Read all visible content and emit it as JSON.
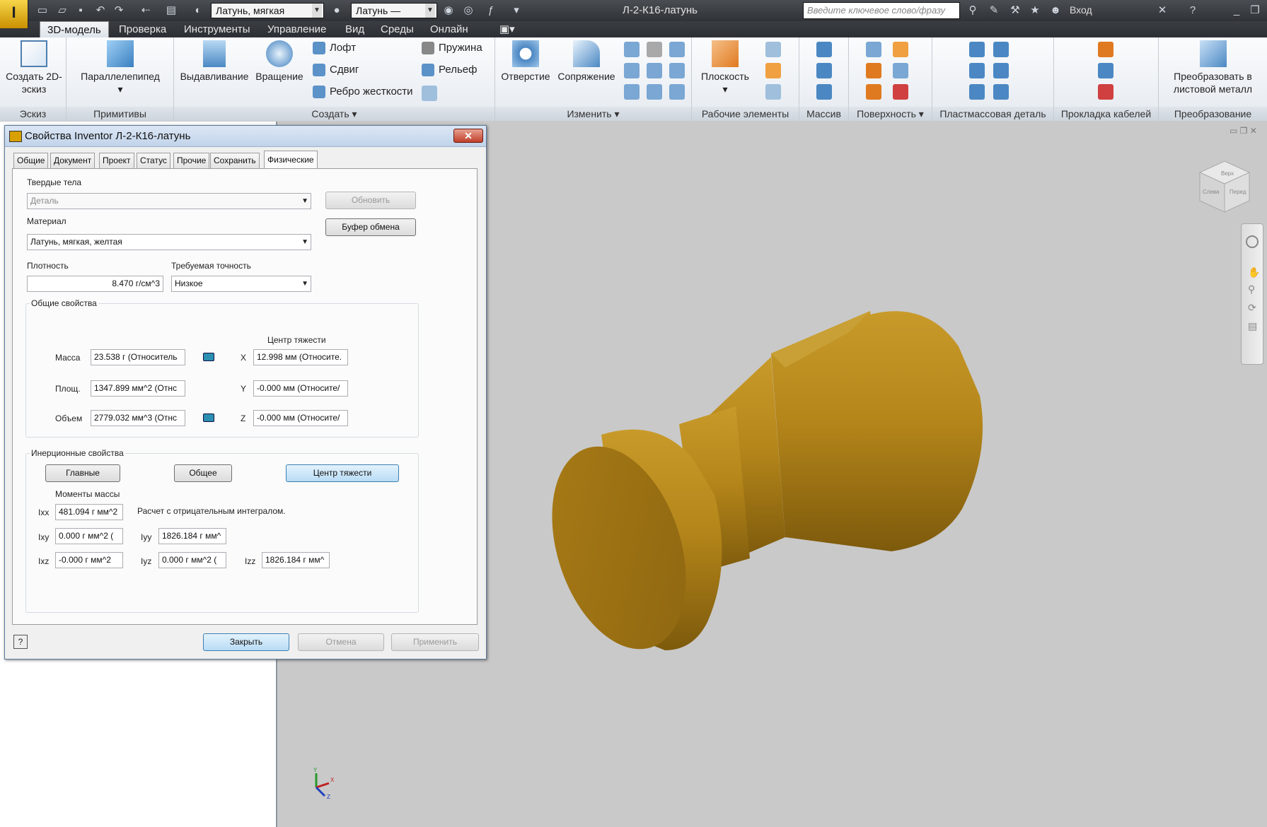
{
  "app": {
    "logo_label": "I",
    "document_title": "Л-2-К16-латунь",
    "search_placeholder": "Введите ключевое слово/фразу",
    "login": "Вход",
    "material_combo": "Латунь, мягкая",
    "appearance_combo": "Латунь —"
  },
  "menu": {
    "tabs": [
      "3D-модель",
      "Проверка",
      "Инструменты",
      "Управление",
      "Вид",
      "Среды",
      "Онлайн"
    ]
  },
  "ribbon": {
    "sketch": {
      "button": "Создать 2D-эскиз",
      "panel": "Эскиз"
    },
    "primitives": {
      "button": "Параллелепипед",
      "panel": "Примитивы"
    },
    "create": {
      "extrude": "Выдавливание",
      "revolve": "Вращение",
      "loft": "Лофт",
      "sweep": "Сдвиг",
      "rib": "Ребро жесткости",
      "coil": "Пружина",
      "emboss": "Рельеф",
      "panel": "Создать"
    },
    "modify": {
      "hole": "Отверстие",
      "fillet": "Сопряжение",
      "panel": "Изменить"
    },
    "work": {
      "plane": "Плоскость",
      "panel": "Рабочие элементы"
    },
    "pattern": {
      "panel": "Массив"
    },
    "surface": {
      "panel": "Поверхность"
    },
    "plastic": {
      "panel": "Пластмассовая деталь"
    },
    "cable": {
      "panel": "Прокладка кабелей"
    },
    "convert": {
      "button": "Преобразовать в листовой металл",
      "panel": "Преобразование"
    }
  },
  "dialog": {
    "title": "Свойства Inventor Л-2-К16-латунь",
    "tabs": [
      "Общие",
      "Документ",
      "Проект",
      "Статус",
      "Прочие",
      "Сохранить",
      "Физические"
    ],
    "solids_label": "Твердые тела",
    "solids_value": "Деталь",
    "update_button": "Обновить",
    "material_label": "Материал",
    "material_value": "Латунь, мягкая, желтая",
    "clipboard_button": "Буфер обмена",
    "density_label": "Плотность",
    "density_value": "8.470 г/см^3",
    "accuracy_label": "Требуемая точность",
    "accuracy_value": "Низкое",
    "general_group": "Общие свойства",
    "cog_header": "Центр тяжести",
    "mass_label": "Масса",
    "mass_value": "23.538 г (Относитель",
    "area_label": "Площ.",
    "area_value": "1347.899 мм^2 (Отнс",
    "volume_label": "Объем",
    "volume_value": "2779.032 мм^3 (Отнс",
    "x_label": "X",
    "x_value": "12.998 мм (Относите.",
    "y_label": "Y",
    "y_value": "-0.000 мм (Относите/",
    "z_label": "Z",
    "z_value": "-0.000 мм (Относите/",
    "inertia_group": "Инерционные свойства",
    "principal_button": "Главные",
    "global_button": "Общее",
    "cog_button": "Центр тяжести",
    "moments_label": "Моменты массы",
    "negative_note": "Расчет с отрицательным интегралом.",
    "ixx_label": "Ixx",
    "ixx_value": "481.094 г мм^2",
    "ixy_label": "Ixy",
    "ixy_value": "0.000 г мм^2 (",
    "ixz_label": "Ixz",
    "ixz_value": "-0.000 г мм^2",
    "iyy_label": "Iyy",
    "iyy_value": "1826.184 г мм^",
    "iyz_label": "Iyz",
    "iyz_value": "0.000 г мм^2 (",
    "izz_label": "Izz",
    "izz_value": "1826.184 г мм^",
    "close_button": "Закрыть",
    "cancel_button": "Отмена",
    "apply_button": "Применить"
  },
  "viewcube": {
    "faces": [
      "Верх",
      "Слева",
      "Перед"
    ]
  },
  "triad": {
    "x": "X",
    "y": "Y",
    "z": "Z"
  },
  "colors": {
    "brass": "#b8860b",
    "accent": "#3c7fb1"
  }
}
